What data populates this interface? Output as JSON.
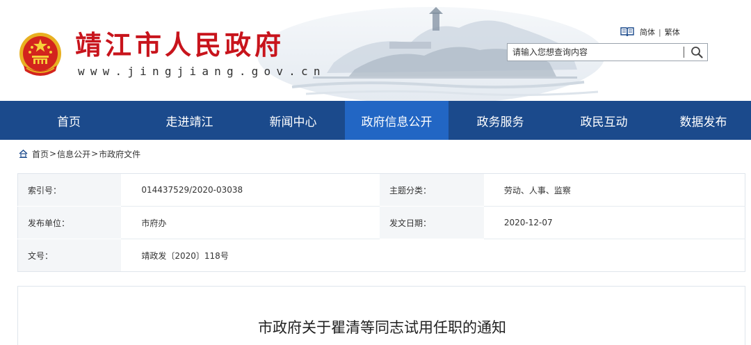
{
  "header": {
    "site_title": "靖江市人民政府",
    "site_url": "www.jingjiang.gov.cn",
    "lang": {
      "simplified": "简体",
      "separator": "|",
      "traditional": "繁体"
    },
    "search": {
      "placeholder": "请输入您想查询内容",
      "value": ""
    },
    "icons": {
      "emblem": "national-emblem",
      "book": "book-icon",
      "search": "search-icon"
    }
  },
  "nav": {
    "items": [
      {
        "label": "首页"
      },
      {
        "label": "走进靖江"
      },
      {
        "label": "新闻中心"
      },
      {
        "label": "政府信息公开",
        "active": true
      },
      {
        "label": "政务服务"
      },
      {
        "label": "政民互动"
      },
      {
        "label": "数据发布"
      }
    ]
  },
  "breadcrumb": {
    "items": [
      "首页",
      "信息公开",
      "市政府文件"
    ],
    "separator": ">"
  },
  "info": {
    "index_label": "索引号：",
    "index_value": "014437529/2020-03038",
    "topic_label": "主题分类：",
    "topic_value": "劳动、人事、监察",
    "publisher_label": "发布单位：",
    "publisher_value": "市府办",
    "date_label": "发文日期：",
    "date_value": "2020-12-07",
    "docno_label": "文号：",
    "docno_value": "靖政发〔2020〕118号"
  },
  "document": {
    "title": "市政府关于瞿清等同志试用任职的通知"
  },
  "colors": {
    "nav_bg": "#1b4a8c",
    "nav_active": "#2266c4",
    "title_red": "#c8141c",
    "label_bg": "#f4f6f8"
  }
}
